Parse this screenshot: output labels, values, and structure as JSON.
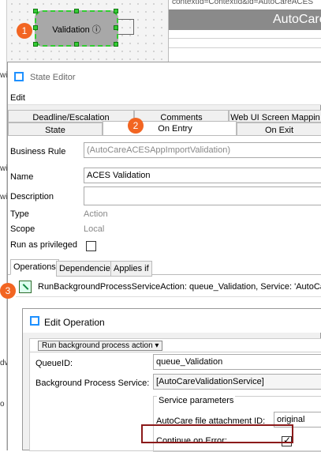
{
  "background": {
    "context_text": "contextId=ContextId&id=AutoCareACES",
    "header_title": "AutoCare",
    "node_label": "Validation ⓘ",
    "left_fragments": [
      "wi",
      "wi",
      "wi",
      "dv",
      "o"
    ]
  },
  "badges": {
    "one": "1",
    "two": "2",
    "three": "3"
  },
  "state_editor": {
    "title": "State Editor",
    "menu_edit": "Edit",
    "tabs_row1": [
      "Deadline/Escalation",
      "Comments",
      "Web UI Screen Mappin"
    ],
    "tabs_row2": [
      "State",
      "On Entry",
      "On Exit"
    ],
    "fields": {
      "business_rule_label": "Business Rule",
      "business_rule_value": "(AutoCareACESAppImportValidation)",
      "name_label": "Name",
      "name_value": "ACES Validation",
      "description_label": "Description",
      "description_value": "",
      "type_label": "Type",
      "type_value": "Action",
      "scope_label": "Scope",
      "scope_value": "Local",
      "run_privileged_label": "Run as privileged"
    },
    "subtabs": [
      "Operations",
      "Dependencies",
      "Applies if"
    ],
    "operation_text": "RunBackgroundProcessServiceAction: queue_Validation, Service: 'AutoCare"
  },
  "edit_operation": {
    "title": "Edit Operation",
    "action_dropdown": "Run background process action",
    "queue_label": "QueueID:",
    "queue_value": "queue_Validation",
    "bps_label": "Background Process Service:",
    "bps_value": "[AutoCareValidationService]",
    "service_params_label": "Service parameters",
    "attachment_label": "AutoCare file attachment ID:",
    "attachment_value": "original",
    "continue_label": "Continue on Error:",
    "continue_checked": true
  },
  "colors": {
    "badge": "#f26522",
    "highlight": "#8b1a1a",
    "node_border": "#33cc33"
  }
}
